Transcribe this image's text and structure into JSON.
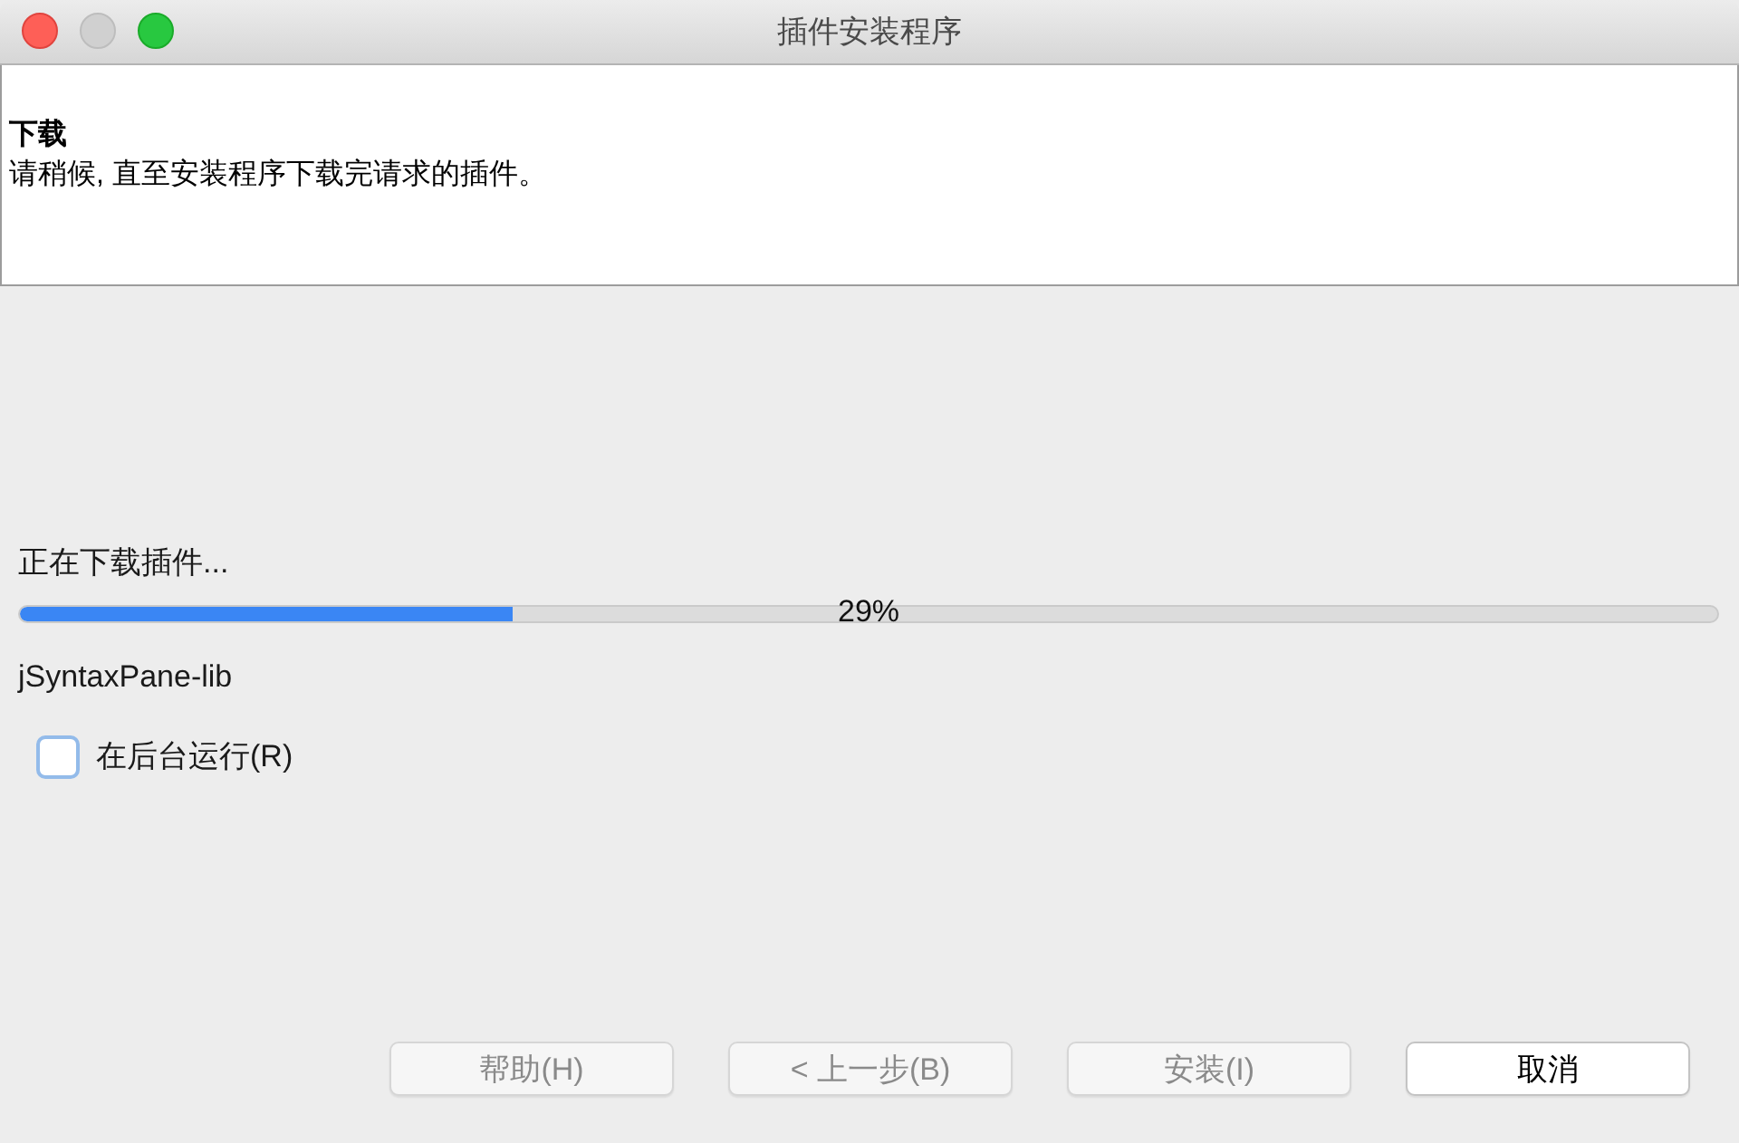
{
  "window": {
    "title": "插件安装程序",
    "controls": [
      {
        "kind": "close",
        "disabled": false
      },
      {
        "kind": "minimize",
        "disabled": true
      },
      {
        "kind": "zoom",
        "disabled": false
      }
    ]
  },
  "header": {
    "title": "下载",
    "description": "请稍候, 直至安装程序下载完请求的插件。"
  },
  "progress": {
    "label": "正在下载插件...",
    "level": 0.29,
    "reading": "29%",
    "item": "jSyntaxPane-lib"
  },
  "background_option": {
    "label": "在后台运行(R)",
    "checked": false
  },
  "buttons": [
    {
      "label": "帮助(H)",
      "disabled": true
    },
    {
      "label": "< 上一步(B)",
      "disabled": true
    },
    {
      "label": "安装(I)",
      "disabled": true
    },
    {
      "label": "取消",
      "disabled": false
    }
  ]
}
